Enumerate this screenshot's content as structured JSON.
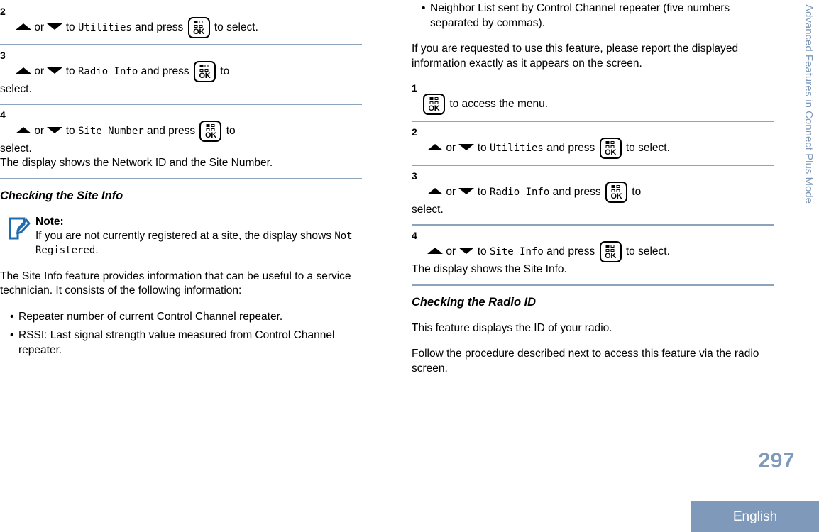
{
  "running_head": "Advanced Features in Connect Plus Mode",
  "folio": "297",
  "language_band": "English",
  "colors": {
    "accent": "#7f99ba",
    "rule": "#8ca3bc",
    "note_icon": "#1f6cb0",
    "text": "#000000"
  },
  "icons": {
    "ok_key_label": "OK",
    "arrow_up": "arrow-up-icon",
    "arrow_down": "arrow-down-icon",
    "note": "note-pencil-icon"
  },
  "left_column": {
    "steps_site_number": [
      {
        "number": "2",
        "parts": {
          "pre": "or",
          "to": "to",
          "menu": "Utilities",
          "and_press": "and press",
          "tail": "to select."
        }
      },
      {
        "number": "3",
        "parts": {
          "pre": "or",
          "to": "to",
          "menu": "Radio Info",
          "and_press": "and press",
          "tail": "to",
          "tail2": "select."
        }
      },
      {
        "number": "4",
        "parts": {
          "pre": "or",
          "to": "to",
          "menu": "Site Number",
          "and_press": "and press",
          "tail": "to",
          "tail2": "select.",
          "result": "The display shows the Network ID and the Site Number."
        }
      }
    ],
    "heading": "Checking the Site Info",
    "note": {
      "title": "Note:",
      "text_before": "If you are not currently registered at a site, the display shows",
      "mono": "Not Registered",
      "text_after": "."
    },
    "intro_paragraph": "The Site Info feature provides information that can be useful to a service technician. It consists of the following information:",
    "bullets": [
      "Repeater number of current Control Channel repeater.",
      "RSSI: Last signal strength value measured from Control Channel repeater."
    ]
  },
  "right_column": {
    "bullets": [
      "Neighbor List sent by Control Channel repeater (five numbers separated by commas)."
    ],
    "paragraph": "If you are requested to use this feature, please report the displayed information exactly as it appears on the screen.",
    "steps_site_info": [
      {
        "number": "1",
        "parts": {
          "tail": "to access the menu."
        }
      },
      {
        "number": "2",
        "parts": {
          "pre": "or",
          "to": "to",
          "menu": "Utilities",
          "and_press": "and press",
          "tail": "to select."
        }
      },
      {
        "number": "3",
        "parts": {
          "pre": "or",
          "to": "to",
          "menu": "Radio Info",
          "and_press": "and press",
          "tail": "to",
          "tail2": "select."
        }
      },
      {
        "number": "4",
        "parts": {
          "pre": "or",
          "to": "to",
          "menu": "Site Info",
          "and_press": "and press",
          "tail": "to select.",
          "result": "The display shows the Site Info."
        }
      }
    ],
    "heading": "Checking the Radio ID",
    "paragraph_1": "This feature displays the ID of your radio.",
    "paragraph_2": "Follow the procedure described next to access this feature via the radio screen."
  }
}
